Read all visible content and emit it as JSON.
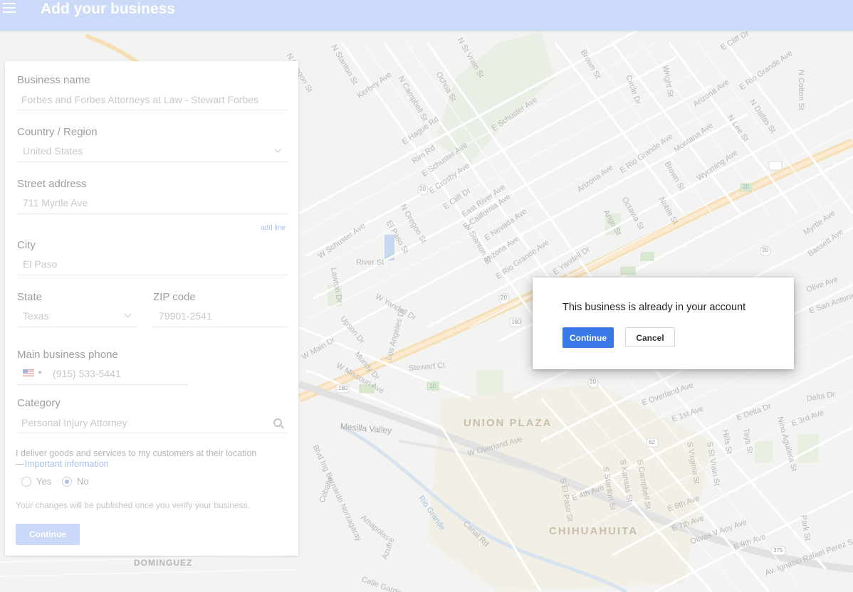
{
  "header": {
    "title": "Add your business",
    "menu_icon": "hamburger-menu-icon"
  },
  "form": {
    "business_name": {
      "label": "Business name",
      "value": "Forbes and Forbes Attorneys at Law - Stewart Forbes"
    },
    "country": {
      "label": "Country / Region",
      "value": "United States"
    },
    "street": {
      "label": "Street address",
      "value": "711 Myrtle Ave",
      "add_line": "add line"
    },
    "city": {
      "label": "City",
      "value": "El Paso"
    },
    "state": {
      "label": "State",
      "value": "Texas"
    },
    "zip": {
      "label": "ZIP code",
      "value": "79901-2541"
    },
    "phone": {
      "label": "Main business phone",
      "value": "(915) 533-5441",
      "flag": "us-flag-icon"
    },
    "category": {
      "label": "Category",
      "value": "Personal Injury Attorney"
    },
    "deliver": {
      "text": "I deliver goods and services to my customers at their location",
      "link_prefix": "—",
      "link": "Important information",
      "yes_label": "Yes",
      "no_label": "No",
      "selected": "No"
    },
    "publish_note": "Your changes will be published once you verify your business.",
    "continue_label": "Continue"
  },
  "dialog": {
    "message": "This business is already in your account",
    "continue_label": "Continue",
    "cancel_label": "Cancel"
  },
  "map": {
    "street_labels": [
      "N Oregon St",
      "N Stanton St",
      "Kerbey Ave",
      "N Campbell St",
      "Ochoa St",
      "N St Vrain St",
      "E Schuster Ave",
      "Brown St",
      "Circle Dr",
      "Wright St",
      "E Cliff Dr",
      "E Rio Grande Ave",
      "N Cotton St",
      "Arizona Ave",
      "N Dallas St",
      "N Lee St",
      "E Hague Rd",
      "Rim Rd",
      "E Schuster Ave",
      "E Crosby Ave",
      "E Cliff Dr",
      "East River Ave",
      "E California Ave",
      "E Nevada Ave",
      "Arizona Ave",
      "E Rio Grande Ave",
      "N Oregon St",
      "N Stanton St",
      "El Paso St",
      "W Schuster Ave",
      "River St",
      "W Yandell Dr",
      "Upson Dr",
      "Mundy Dr",
      "W Missouri Ave",
      "Los Angeles Dr",
      "Stewart Ct",
      "W Main Dr",
      "Lawton Dr",
      "E Yandell Dr",
      "Montana Ave",
      "Wyoming Ave",
      "Octavia St",
      "Noble St",
      "Ange St",
      "Brown St",
      "E Rio Grande Ave",
      "Arizona Ave",
      "Myrtle Ave",
      "Bassett Ave",
      "Olive Ave",
      "E San Antonio",
      "E Overland Ave",
      "E 1st Ave",
      "E Delta Dr",
      "Delta Dr",
      "E 3rd Ave",
      "Nino Aguilera St",
      "W Overland Ave",
      "S Kansas St",
      "S Campbell St",
      "S Virginia St",
      "S St Vrain St",
      "Hills St",
      "Tays St",
      "E 4th Ave",
      "E 6th Ave",
      "E 7th Ave",
      "Olivas V Aoy Ave",
      "E 9th Ave",
      "Park St",
      "S El Paso St",
      "S Stanton St",
      "Blvd Ing Bernardo Norzagaray",
      "Amapolas",
      "Azufre",
      "Calle Gardenia",
      "Canal Rd",
      "Av. Ignacio Rafael Perez Serna",
      "Cobalto",
      "Mesilla Valley",
      "Rio Grande"
    ],
    "neighborhoods": [
      "UNION PLAZA",
      "CHIHUAHUITA",
      "DOMINGUEZ"
    ],
    "shields": [
      "20",
      "20",
      "20",
      "20",
      "180",
      "180",
      "62",
      "20",
      "375",
      "10"
    ]
  }
}
